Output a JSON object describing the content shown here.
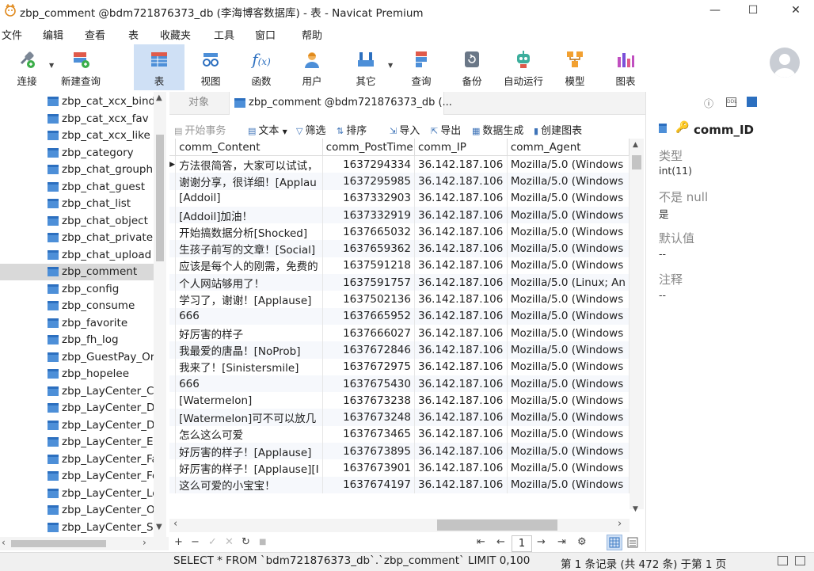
{
  "window": {
    "title": "zbp_comment @bdm721876373_db (李海博客数据库) - 表 - Navicat Premium",
    "minimize": "—",
    "maximize": "☐",
    "close": "✕"
  },
  "menu": [
    "文件",
    "编辑",
    "查看",
    "表",
    "收藏夹",
    "工具",
    "窗口",
    "帮助"
  ],
  "toolbar": [
    {
      "label": "连接",
      "icon": "connect-icon"
    },
    {
      "label": "新建查询",
      "icon": "new-query-icon"
    },
    {
      "label": "表",
      "icon": "table-icon"
    },
    {
      "label": "视图",
      "icon": "view-icon"
    },
    {
      "label": "函数",
      "icon": "function-icon"
    },
    {
      "label": "用户",
      "icon": "user-icon"
    },
    {
      "label": "其它",
      "icon": "other-icon"
    },
    {
      "label": "查询",
      "icon": "query-icon"
    },
    {
      "label": "备份",
      "icon": "backup-icon"
    },
    {
      "label": "自动运行",
      "icon": "robot-icon"
    },
    {
      "label": "模型",
      "icon": "model-icon"
    },
    {
      "label": "图表",
      "icon": "chart-icon"
    }
  ],
  "tree": {
    "items": [
      "zbp_cat_xcx_bind",
      "zbp_cat_xcx_fav",
      "zbp_cat_xcx_like",
      "zbp_category",
      "zbp_chat_grouphis",
      "zbp_chat_guest",
      "zbp_chat_list",
      "zbp_chat_object",
      "zbp_chat_privatehi",
      "zbp_chat_upload",
      "zbp_comment",
      "zbp_config",
      "zbp_consume",
      "zbp_favorite",
      "zbp_fh_log",
      "zbp_GuestPay_Orc",
      "zbp_hopelee",
      "zbp_LayCenter_Co",
      "zbp_LayCenter_De",
      "zbp_LayCenter_Dr",
      "zbp_LayCenter_Em",
      "zbp_LayCenter_Fav",
      "zbp_LayCenter_Fee",
      "zbp_LayCenter_Log",
      "zbp_LayCenter_Ord",
      "zbp_LayCenter_Sig"
    ],
    "selected": "zbp_comment"
  },
  "tabs": {
    "objects": "对象",
    "active": "zbp_comment @bdm721876373_db (..."
  },
  "grid_toolbar": {
    "begin_tx": "开始事务",
    "text": "文本",
    "filter": "筛选",
    "sort": "排序",
    "import": "导入",
    "export": "导出",
    "datagen": "数据生成",
    "create_chart": "创建图表"
  },
  "grid": {
    "columns": [
      "comm_Content",
      "comm_PostTime",
      "comm_IP",
      "comm_Agent"
    ],
    "rows": [
      [
        "方法很简答，大家可以试试，",
        "1637294334",
        "36.142.187.106",
        "Mozilla/5.0 (Windows"
      ],
      [
        "谢谢分享，很详细！[Applau",
        "1637295985",
        "36.142.187.106",
        "Mozilla/5.0 (Windows"
      ],
      [
        "[Addoil]",
        "1637332903",
        "36.142.187.106",
        "Mozilla/5.0 (Windows"
      ],
      [
        "[Addoil]加油！",
        "1637332919",
        "36.142.187.106",
        "Mozilla/5.0 (Windows"
      ],
      [
        "开始搞数据分析[Shocked]",
        "1637665032",
        "36.142.187.106",
        "Mozilla/5.0 (Windows"
      ],
      [
        "生孩子前写的文章！[Social]",
        "1637659362",
        "36.142.187.106",
        "Mozilla/5.0 (Windows"
      ],
      [
        "应该是每个人的刚需，免费的",
        "1637591218",
        "36.142.187.106",
        "Mozilla/5.0 (Windows"
      ],
      [
        "个人网站够用了！",
        "1637591757",
        "36.142.187.106",
        "Mozilla/5.0 (Linux; An"
      ],
      [
        "学习了，谢谢！[Applause]",
        "1637502136",
        "36.142.187.106",
        "Mozilla/5.0 (Windows"
      ],
      [
        "666",
        "1637665952",
        "36.142.187.106",
        "Mozilla/5.0 (Windows"
      ],
      [
        "好厉害的样子",
        "1637666027",
        "36.142.187.106",
        "Mozilla/5.0 (Windows"
      ],
      [
        "我最爱的唐晶！[NoProb]",
        "1637672846",
        "36.142.187.106",
        "Mozilla/5.0 (Windows"
      ],
      [
        "我来了！[Sinistersmile]",
        "1637672975",
        "36.142.187.106",
        "Mozilla/5.0 (Windows"
      ],
      [
        "666",
        "1637675430",
        "36.142.187.106",
        "Mozilla/5.0 (Windows"
      ],
      [
        "[Watermelon]",
        "1637673238",
        "36.142.187.106",
        "Mozilla/5.0 (Windows"
      ],
      [
        "[Watermelon]可不可以放几",
        "1637673248",
        "36.142.187.106",
        "Mozilla/5.0 (Windows"
      ],
      [
        "怎么这么可爱",
        "1637673465",
        "36.142.187.106",
        "Mozilla/5.0 (Windows"
      ],
      [
        "好厉害的样子！[Applause]",
        "1637673895",
        "36.142.187.106",
        "Mozilla/5.0 (Windows"
      ],
      [
        "好厉害的样子！[Applause][I",
        "1637673901",
        "36.142.187.106",
        "Mozilla/5.0 (Windows"
      ],
      [
        "这么可爱的小宝宝！",
        "1637674197",
        "36.142.187.106",
        "Mozilla/5.0 (Windows"
      ]
    ]
  },
  "grid_nav": {
    "add": "+",
    "remove": "−",
    "apply": "✓",
    "discard": "✕",
    "refresh": "↻",
    "stop": "■",
    "first": "⇤",
    "prev": "←",
    "page": "1",
    "next": "→",
    "last": "⇥",
    "settings": "⚙"
  },
  "right_panel": {
    "field_name": "comm_ID",
    "type_label": "类型",
    "type_value": "int(11)",
    "notnull_label": "不是 null",
    "notnull_value": "是",
    "default_label": "默认值",
    "default_value": "--",
    "comment_label": "注释",
    "comment_value": "--"
  },
  "status": {
    "sql": "SELECT * FROM `bdm721876373_db`.`zbp_comment` LIMIT 0,100",
    "records": "第 1 条记录 (共 472 条) 于第 1 页"
  }
}
